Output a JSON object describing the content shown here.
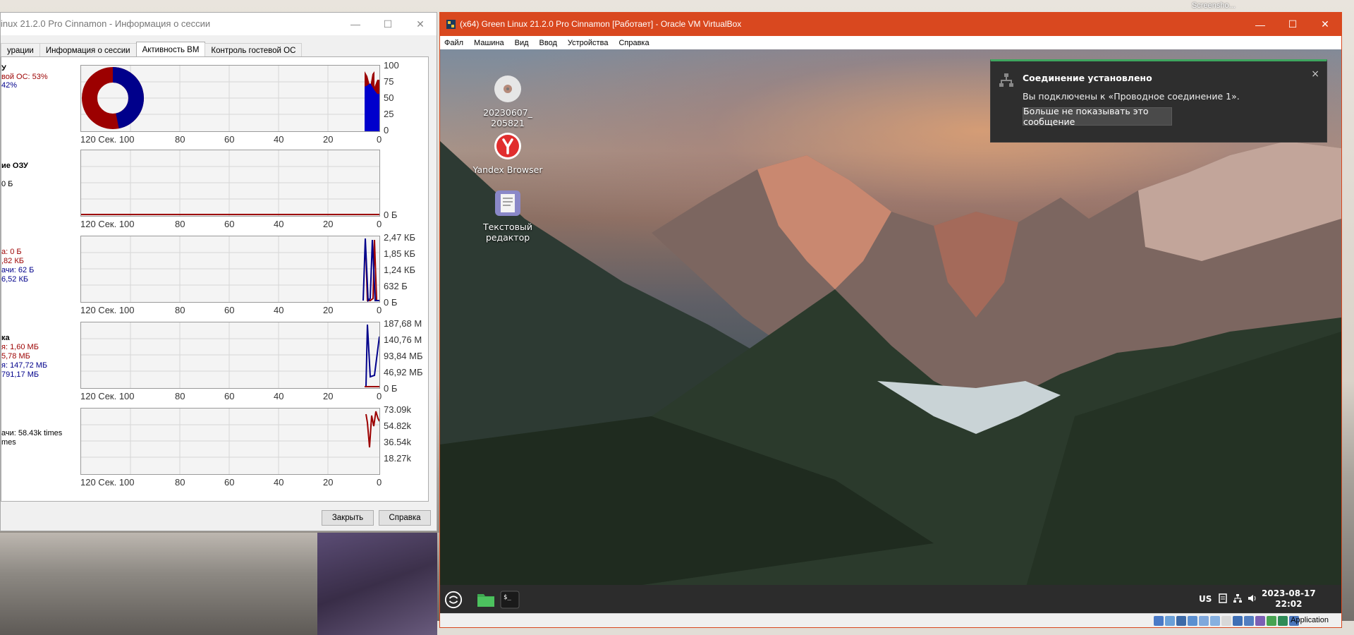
{
  "host": {
    "screenshot_label": "Screensho..."
  },
  "session_window": {
    "title": "inux 21.2.0 Pro Cinnamon - Информация о сессии",
    "tabs": [
      {
        "label": "урации",
        "active": false
      },
      {
        "label": "Информация о сессии",
        "active": false
      },
      {
        "label": "Активность ВМ",
        "active": true
      },
      {
        "label": "Контроль гостевой ОС",
        "active": false
      }
    ],
    "cpu": {
      "heading": "У",
      "line1": "вой ОС: 53%",
      "line2": "42%",
      "y_ticks": [
        "100",
        "75",
        "50",
        "25",
        "0"
      ]
    },
    "ram": {
      "heading": "ие ОЗУ",
      "line1": "0 Б",
      "y_ticks": [
        "0 Б"
      ]
    },
    "network": {
      "heading": "",
      "line1": "а: 0 Б",
      "line2": ",82 КБ",
      "line3": "ачи: 62 Б",
      "line4": " 6,52 КБ",
      "y_ticks": [
        "2,47 КБ",
        "1,85 КБ",
        "1,24 КБ",
        "632 Б",
        "0 Б"
      ]
    },
    "disk": {
      "heading": "ка",
      "line1": "я: 1,60 МБ",
      "line2": "5,78 МБ",
      "line3": "я: 147,72 МБ",
      "line4": " 791,17 МБ",
      "y_ticks": [
        "187,68 М",
        "140,76 М",
        "93,84 МБ",
        "46,92 МБ",
        "0 Б"
      ]
    },
    "vmexit": {
      "line1": "ачи: 58.43k times",
      "line2": "mes",
      "y_ticks": [
        "73.09k",
        "54.82k",
        "36.54k",
        "18.27k"
      ]
    },
    "x_axis": [
      "120 Сек. 100",
      "80",
      "60",
      "40",
      "20",
      "0"
    ],
    "buttons": {
      "close": "Закрыть",
      "help": "Справка"
    },
    "chart_data": [
      {
        "type": "pie",
        "title": "",
        "values": [
          47,
          53
        ],
        "colors": [
          "#00008b",
          "#9c0000"
        ]
      },
      {
        "type": "line",
        "title": "",
        "ylim": [
          0,
          100
        ],
        "series_colors": [
          "#00008b",
          "#9c0000"
        ]
      }
    ]
  },
  "vbox": {
    "title": "(x64) Green Linux 21.2.0 Pro Cinnamon [Работает] - Oracle VM VirtualBox",
    "menu": [
      "Файл",
      "Машина",
      "Вид",
      "Ввод",
      "Устройства",
      "Справка"
    ],
    "status_app_label": "Application",
    "desktop_icons": [
      {
        "label": "20230607_\n205821",
        "icon": "disc-icon"
      },
      {
        "label": "Yandex Browser",
        "icon": "yandex-icon"
      },
      {
        "label": "Текстовый\nредактор",
        "icon": "text-editor-icon"
      }
    ],
    "notification": {
      "title": "Соединение установлено",
      "body": "Вы подключены к «Проводное соединение 1».",
      "button": "Больше не показывать это сообщение",
      "close": "×"
    },
    "panel": {
      "keyboard_layout": "US",
      "date": "2023-08-17",
      "time": "22:02"
    }
  }
}
